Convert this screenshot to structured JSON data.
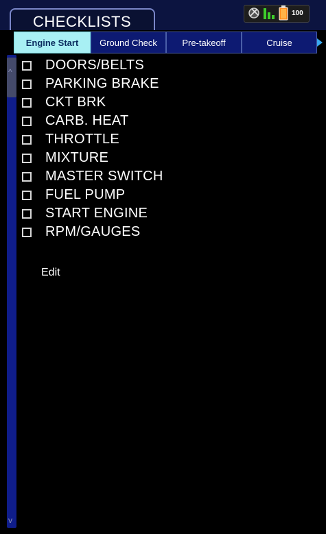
{
  "header": {
    "title": "CHECKLISTS",
    "status": {
      "gps_icon": "satellite-icon",
      "signal_icon": "signal-bars-icon",
      "battery_icon": "battery-icon",
      "battery_level": "100"
    }
  },
  "tabs": [
    {
      "label": "Engine Start",
      "active": true
    },
    {
      "label": "Ground Check",
      "active": false
    },
    {
      "label": "Pre-takeoff",
      "active": false
    },
    {
      "label": "Cruise",
      "active": false
    }
  ],
  "checklist": {
    "items": [
      {
        "label": "DOORS/BELTS",
        "checked": false
      },
      {
        "label": "PARKING BRAKE",
        "checked": false
      },
      {
        "label": "CKT BRK",
        "checked": false
      },
      {
        "label": "CARB. HEAT",
        "checked": false
      },
      {
        "label": "THROTTLE",
        "checked": false
      },
      {
        "label": "MIXTURE",
        "checked": false
      },
      {
        "label": "MASTER SWITCH",
        "checked": false
      },
      {
        "label": "FUEL PUMP",
        "checked": false
      },
      {
        "label": "START ENGINE",
        "checked": false
      },
      {
        "label": "RPM/GAUGES",
        "checked": false
      }
    ],
    "edit_label": "Edit"
  }
}
